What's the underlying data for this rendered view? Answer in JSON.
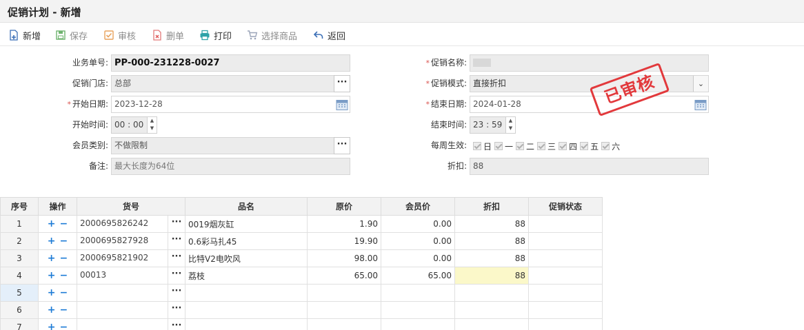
{
  "title": "促销计划 - 新增",
  "toolbar": {
    "new": "新增",
    "save": "保存",
    "audit": "审核",
    "delete": "删单",
    "print": "打印",
    "select_goods": "选择商品",
    "back": "返回"
  },
  "form": {
    "doc_no_label": "业务单号:",
    "doc_no": "PP-000-231228-0027",
    "store_label": "促销门店:",
    "store": "总部",
    "start_date_label": "开始日期:",
    "start_date": "2023-12-28",
    "start_time_label": "开始时间:",
    "start_hour": "00",
    "start_min": "00",
    "member_type_label": "会员类别:",
    "member_type": "不做限制",
    "remark_label": "备注:",
    "remark_placeholder": "最大长度为64位",
    "promo_name_label": "促销名称:",
    "promo_mode_label": "促销模式:",
    "promo_mode": "直接折扣",
    "end_date_label": "结束日期:",
    "end_date": "2024-01-28",
    "end_time_label": "结束时间:",
    "end_hour": "23",
    "end_min": "59",
    "weekly_label": "每周生效:",
    "weekdays": [
      "日",
      "一",
      "二",
      "三",
      "四",
      "五",
      "六"
    ],
    "discount_label": "折扣:",
    "discount": "88",
    "time_sep": ":",
    "required_mark": "*",
    "ellipsis": "···",
    "spin_up": "▲",
    "spin_down": "▼",
    "dropdown_arrow": "⌄"
  },
  "stamp": "已审核",
  "table": {
    "headers": [
      "序号",
      "操作",
      "货号",
      "品名",
      "原价",
      "会员价",
      "折扣",
      "促销状态"
    ],
    "add_op": "+",
    "remove_op": "−",
    "rows": [
      {
        "seq": "1",
        "code": "2000695826242",
        "name": "0019烟灰缸",
        "price": "1.90",
        "member_price": "0.00",
        "discount": "88",
        "status": ""
      },
      {
        "seq": "2",
        "code": "2000695827928",
        "name": "0.6彩马扎45",
        "price": "19.90",
        "member_price": "0.00",
        "discount": "88",
        "status": ""
      },
      {
        "seq": "3",
        "code": "2000695821902",
        "name": "比特V2电吹风",
        "price": "98.00",
        "member_price": "0.00",
        "discount": "88",
        "status": ""
      },
      {
        "seq": "4",
        "code": "00013",
        "name": "荔枝",
        "price": "65.00",
        "member_price": "65.00",
        "discount": "88",
        "status": ""
      },
      {
        "seq": "5",
        "code": "",
        "name": "",
        "price": "",
        "member_price": "",
        "discount": "",
        "status": ""
      },
      {
        "seq": "6",
        "code": "",
        "name": "",
        "price": "",
        "member_price": "",
        "discount": "",
        "status": ""
      },
      {
        "seq": "7",
        "code": "",
        "name": "",
        "price": "",
        "member_price": "",
        "discount": "",
        "status": ""
      }
    ]
  },
  "colors": {
    "required": "#d9534f",
    "stamp": "#e2393c",
    "op_blue": "#1d7bd6",
    "highlight": "#fbf8c9"
  }
}
